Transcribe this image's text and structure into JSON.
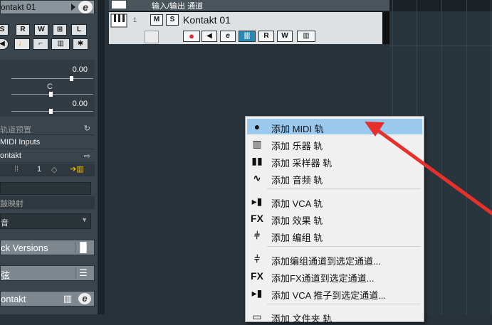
{
  "inspector": {
    "track_name_top": "ontakt 01",
    "buttons_row1": [
      "S",
      "R",
      "W",
      "⊞",
      "L"
    ],
    "fader_values": [
      "0.00",
      "0.00"
    ],
    "pan_label": "C",
    "rows": [
      {
        "label": "轨道预置",
        "right": "↻"
      },
      {
        "label": "MIDI Inputs",
        "right": ""
      },
      {
        "label": "ontakt",
        "right": "⇨"
      }
    ],
    "channel_value": "1",
    "bank_row": "鼓映射",
    "sound_row": "音",
    "track_versions": "ck Versions",
    "chord_row": "弦",
    "instrument_footer": "ontakt"
  },
  "tracklist": {
    "io_track_label": "输入/输出 通道",
    "track_number": "1",
    "track_name": "Kontakt 01",
    "track_buttons": [
      "M",
      "S"
    ],
    "track_tools": [
      "●",
      "◀",
      "e",
      "|||",
      "R",
      "W",
      "▥"
    ]
  },
  "context_menu": {
    "items": [
      {
        "icon": "midi-icon",
        "label": "添加 MIDI 轨",
        "highlighted": true
      },
      {
        "icon": "instrument-icon",
        "label": "添加 乐器 轨"
      },
      {
        "icon": "sampler-icon",
        "label": "添加 采样器 轨"
      },
      {
        "icon": "audio-icon",
        "label": "添加 音频 轨"
      },
      {
        "icon": "vca-icon",
        "label": "添加 VCA 轨"
      },
      {
        "icon": "fx-icon",
        "label": "添加 效果 轨"
      },
      {
        "icon": "group-icon",
        "label": "添加 编组 轨"
      },
      {
        "icon": "group-icon",
        "label": "添加编组通道到选定通道..."
      },
      {
        "icon": "fx-icon",
        "label": "添加FX通道到选定通道..."
      },
      {
        "icon": "vca-icon",
        "label": "添加 VCA 推子到选定通道..."
      },
      {
        "icon": "folder-icon",
        "label": "添加 文件夹 轨"
      }
    ],
    "fx_glyph": "FX"
  },
  "colors": {
    "highlight": "#99c9ef",
    "arrow": "#e8302a",
    "record": "#e0283a"
  }
}
